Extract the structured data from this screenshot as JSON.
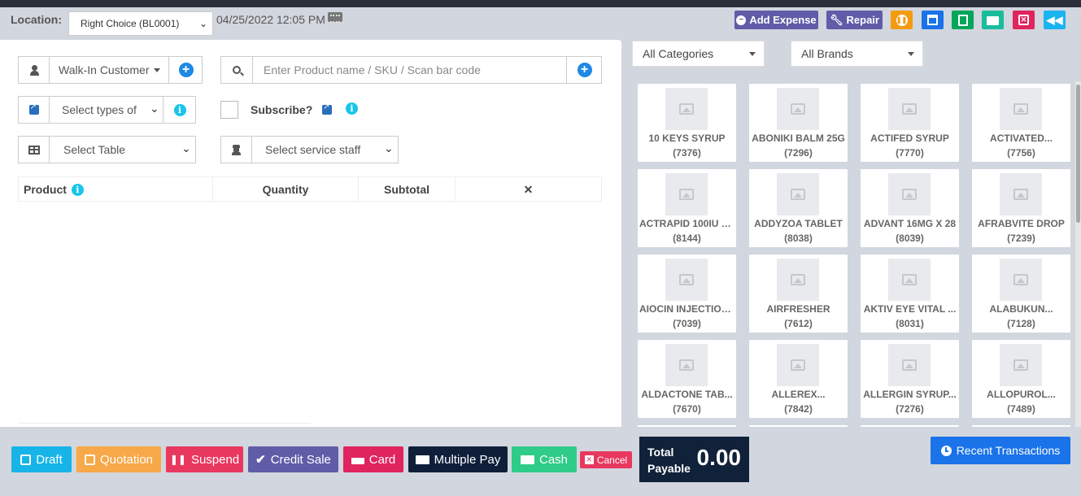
{
  "location": {
    "label": "Location:",
    "selected": "Right Choice (BL0001)",
    "datetime": "04/25/2022 12:05 PM"
  },
  "top_buttons": {
    "add_expense": "Add Expense",
    "repair": "Repair"
  },
  "customer": {
    "selected": "Walk-In Customer"
  },
  "search": {
    "placeholder": "Enter Product name / SKU / Scan bar code"
  },
  "types": {
    "placeholder": "Select types of"
  },
  "subscribe": {
    "label": "Subscribe?"
  },
  "table_select": {
    "placeholder": "Select Table"
  },
  "staff_select": {
    "placeholder": "Select service staff"
  },
  "cart_table": {
    "columns": [
      "Product",
      "Quantity",
      "Subtotal",
      "✕"
    ]
  },
  "filters": {
    "category": "All Categories",
    "brand": "All Brands"
  },
  "products": [
    {
      "name": "10 KEYS SYRUP",
      "code": "(7376)"
    },
    {
      "name": "ABONIKI BALM 25G",
      "code": "(7296)"
    },
    {
      "name": "ACTIFED SYRUP",
      "code": "(7770)"
    },
    {
      "name": "ACTIVATED...",
      "code": "(7756)"
    },
    {
      "name": "ACTRAPID 100IU X...",
      "code": "(8144)"
    },
    {
      "name": "ADDYZOA TABLET",
      "code": "(8038)"
    },
    {
      "name": "ADVANT 16MG X 28",
      "code": "(8039)"
    },
    {
      "name": "AFRABVITE DROP",
      "code": "(7239)"
    },
    {
      "name": "AIOCIN INJECTION...",
      "code": "(7039)"
    },
    {
      "name": "AIRFRESHER",
      "code": "(7612)"
    },
    {
      "name": "AKTIV EYE VITAL ...",
      "code": "(8031)"
    },
    {
      "name": "ALABUKUN...",
      "code": "(7128)"
    },
    {
      "name": "ALDACTONE TAB...",
      "code": "(7670)"
    },
    {
      "name": "ALLEREX...",
      "code": "(7842)"
    },
    {
      "name": "ALLERGIN SYRUP...",
      "code": "(7276)"
    },
    {
      "name": "ALLOPUROL...",
      "code": "(7489)"
    }
  ],
  "actions": {
    "draft": "Draft",
    "quotation": "Quotation",
    "suspend": "Suspend",
    "credit_sale": "Credit Sale",
    "card": "Card",
    "multiple_pay": "Multiple Pay",
    "cash": "Cash",
    "cancel": "Cancel"
  },
  "total": {
    "label_line1": "Total",
    "label_line2": "Payable",
    "amount": "0.00"
  },
  "recent": {
    "label": "Recent Transactions"
  },
  "colors": {
    "add_expense": "#605ca8",
    "repair": "#605ca8",
    "pause": "#f39c12",
    "calc_blue": "#1a73e8",
    "calc_green": "#00a65a",
    "briefcase": "#1abc9c",
    "close": "#e0245e",
    "back": "#1ab4f0",
    "draft": "#17b4e8",
    "quotation": "#f7a848",
    "suspend": "#e8385f",
    "credit_sale": "#605ca8",
    "card": "#e0245e",
    "multiple_pay": "#0f1f3a",
    "cash": "#2ecc87",
    "cancel": "#e8385f"
  }
}
